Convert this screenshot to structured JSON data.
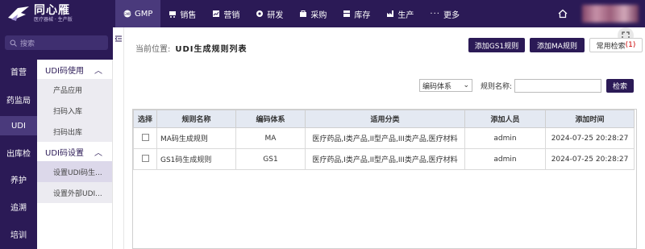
{
  "app": {
    "name": "同心雁",
    "subtitle": "医疗器械 · 生产版"
  },
  "nav": [
    {
      "label": "GMP",
      "icon": "gmp-badge-icon",
      "active": true
    },
    {
      "label": "销售",
      "icon": "cart-icon"
    },
    {
      "label": "营销",
      "icon": "chart-icon"
    },
    {
      "label": "研发",
      "icon": "gear-icon"
    },
    {
      "label": "采购",
      "icon": "bag-icon"
    },
    {
      "label": "库存",
      "icon": "box-icon"
    },
    {
      "label": "生产",
      "icon": "factory-icon"
    },
    {
      "label": "更多",
      "icon": "more-dots-icon"
    }
  ],
  "search": {
    "placeholder": "搜索"
  },
  "sidebar": [
    "首营",
    "药监局",
    "UDI",
    "出库检",
    "养护",
    "追溯",
    "培训"
  ],
  "submenu": {
    "group1": "UDI码使用",
    "items1": [
      "产品应用",
      "扫码入库",
      "扫码出库"
    ],
    "group2": "UDI码设置",
    "items2": [
      "设置UDI码生...",
      "设置外部UDI..."
    ]
  },
  "page": {
    "crumb_prefix": "当前位置:",
    "crumb_title": "UDI生成规则列表",
    "btn_add_gs1": "添加GS1规则",
    "btn_add_ma": "添加MA规则",
    "btn_common_search": "常用检索",
    "common_search_count": "(1)"
  },
  "filter": {
    "select_value": "编码体系",
    "name_label": "规则名称:",
    "search_btn": "检索"
  },
  "table": {
    "headers": [
      "选择",
      "规则名称",
      "编码体系",
      "适用分类",
      "添加人员",
      "添加时间"
    ],
    "rows": [
      {
        "name": "MA码生成规则",
        "system": "MA",
        "category": "医疗药品,I类产品,II型产品,III类产品,医疗材料",
        "user": "admin",
        "time": "2024-07-25 20:28:27"
      },
      {
        "name": "GS1码生成规则",
        "system": "GS1",
        "category": "医疗药品,I类产品,II型产品,III类产品,医疗材料",
        "user": "admin",
        "time": "2024-07-25 20:28:27"
      }
    ]
  },
  "colors": {
    "brand": "#2b1a56",
    "active": "#4a3a7c",
    "header_bg": "#e4e9f2"
  }
}
